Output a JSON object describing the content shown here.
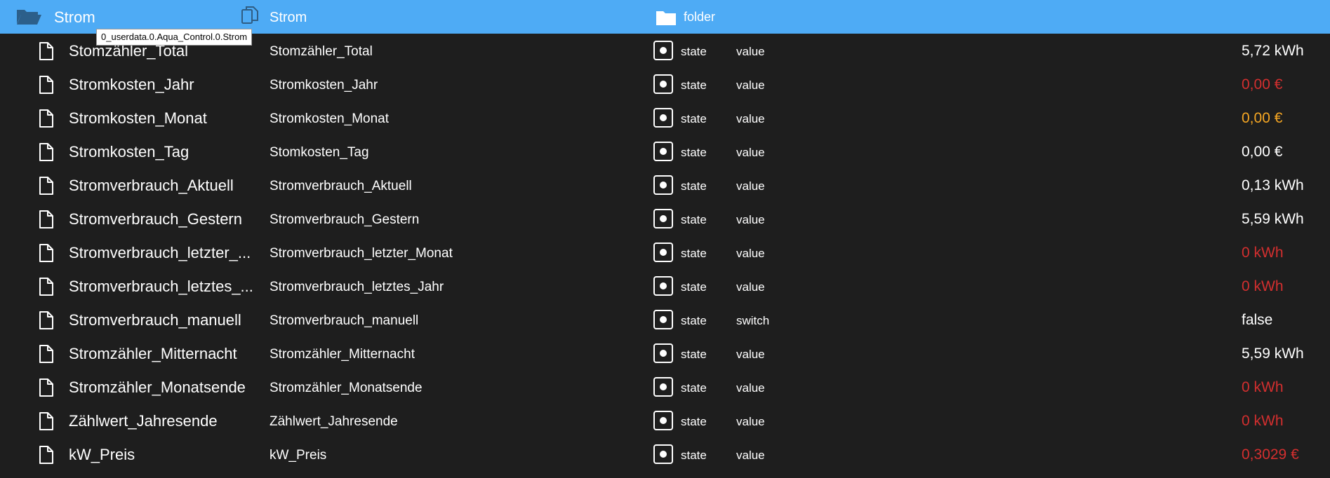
{
  "header": {
    "title": "Strom",
    "name": "Strom",
    "type": "folder"
  },
  "tooltip": "0_userdata.0.Aqua_Control.0.Strom",
  "colors": {
    "header_bg": "#4eabf5",
    "background": "#1e1e1e",
    "value_white": "#ffffff",
    "value_red": "#d32f2f",
    "value_orange": "#f5a623"
  },
  "rows": [
    {
      "id": "Stomzähler_Total",
      "name": "Stomzähler_Total",
      "type": "state",
      "role": "value",
      "value": "5,72 kWh",
      "color": "#ffffff"
    },
    {
      "id": "Stromkosten_Jahr",
      "name": "Stromkosten_Jahr",
      "type": "state",
      "role": "value",
      "value": "0,00 €",
      "color": "#d32f2f"
    },
    {
      "id": "Stromkosten_Monat",
      "name": "Stromkosten_Monat",
      "type": "state",
      "role": "value",
      "value": "0,00 €",
      "color": "#f5a623"
    },
    {
      "id": "Stromkosten_Tag",
      "name": "Stomkosten_Tag",
      "type": "state",
      "role": "value",
      "value": "0,00 €",
      "color": "#ffffff"
    },
    {
      "id": "Stromverbrauch_Aktuell",
      "name": "Stromverbrauch_Aktuell",
      "type": "state",
      "role": "value",
      "value": "0,13 kWh",
      "color": "#ffffff"
    },
    {
      "id": "Stromverbrauch_Gestern",
      "name": "Stromverbrauch_Gestern",
      "type": "state",
      "role": "value",
      "value": "5,59 kWh",
      "color": "#ffffff"
    },
    {
      "id": "Stromverbrauch_letzter_...",
      "name": "Stromverbrauch_letzter_Monat",
      "type": "state",
      "role": "value",
      "value": "0 kWh",
      "color": "#d32f2f"
    },
    {
      "id": "Stromverbrauch_letztes_...",
      "name": "Stromverbrauch_letztes_Jahr",
      "type": "state",
      "role": "value",
      "value": "0 kWh",
      "color": "#d32f2f"
    },
    {
      "id": "Stromverbrauch_manuell",
      "name": "Stromverbrauch_manuell",
      "type": "state",
      "role": "switch",
      "value": "false",
      "color": "#ffffff"
    },
    {
      "id": "Stromzähler_Mitternacht",
      "name": "Stromzähler_Mitternacht",
      "type": "state",
      "role": "value",
      "value": "5,59 kWh",
      "color": "#ffffff"
    },
    {
      "id": "Stromzähler_Monatsende",
      "name": "Stromzähler_Monatsende",
      "type": "state",
      "role": "value",
      "value": "0 kWh",
      "color": "#d32f2f"
    },
    {
      "id": "Zählwert_Jahresende",
      "name": "Zählwert_Jahresende",
      "type": "state",
      "role": "value",
      "value": "0 kWh",
      "color": "#d32f2f"
    },
    {
      "id": "kW_Preis",
      "name": "kW_Preis",
      "type": "state",
      "role": "value",
      "value": "0,3029 €",
      "color": "#d32f2f"
    }
  ]
}
